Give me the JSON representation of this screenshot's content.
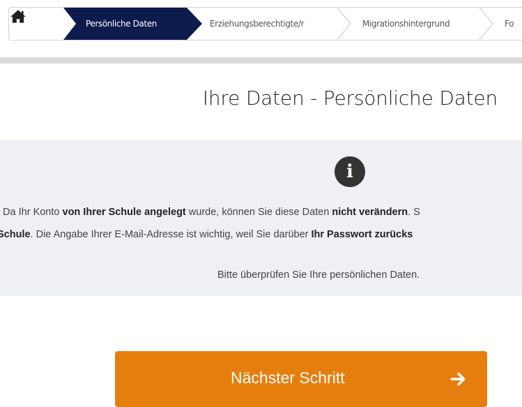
{
  "stepper": {
    "home_icon": "home-icon",
    "steps": [
      {
        "label": "Persönliche Daten",
        "active": true
      },
      {
        "label": "Erziehungsberechtigte/r",
        "active": false
      },
      {
        "label": "Migrationshintergrund",
        "active": false
      },
      {
        "label": "Fo",
        "active": false
      }
    ],
    "active_color": "#0d1b4d"
  },
  "page_title": "Ihre Daten - Persönliche Daten",
  "info": {
    "icon": "info-icon",
    "line1": {
      "t1": ". Da Ihr Konto ",
      "b1": "von Ihrer Schule angelegt",
      "t2": " wurde, können Sie diese Daten ",
      "b2": "nicht verändern",
      "t3": ". S"
    },
    "line2": {
      "b1": "Schule",
      "t1": ". Die Angabe Ihrer E-Mail-Adresse ist wichtig, weil Sie darüber ",
      "b2": "Ihr Passwort zurücks"
    },
    "line3": "Bitte überprüfen Sie Ihre persönlichen Daten."
  },
  "next_button": {
    "label": "Nächster Schritt",
    "icon": "arrow-right-icon",
    "color": "#e67e0e"
  }
}
